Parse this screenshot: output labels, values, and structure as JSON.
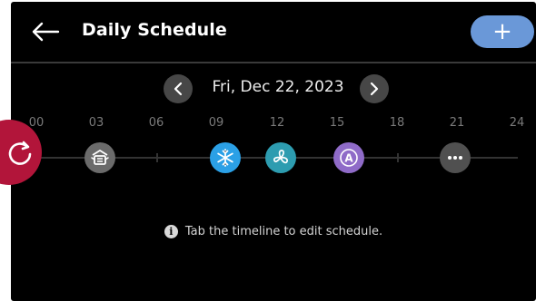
{
  "header": {
    "title": "Daily Schedule",
    "add_label": "+"
  },
  "date_nav": {
    "date": "Fri, Dec 22, 2023"
  },
  "timeline": {
    "hour_labels": [
      "00",
      "03",
      "06",
      "09",
      "12",
      "15",
      "18",
      "21",
      "24"
    ],
    "events": [
      {
        "name": "dehumidify-event",
        "icon": "dehumidify-icon",
        "color": "#6b6b6b"
      },
      {
        "name": "cool-event",
        "icon": "snowflake-icon",
        "color": "#2ba0e6"
      },
      {
        "name": "fan-event",
        "icon": "fan-icon",
        "color": "#2d9cb0"
      },
      {
        "name": "auto-event",
        "icon": "auto-mode-icon",
        "color": "#8f6bc8",
        "label": "A"
      },
      {
        "name": "more-event",
        "icon": "more-icon",
        "color": "#505050"
      }
    ]
  },
  "info": {
    "text": "Tab the timeline to edit schedule."
  },
  "overlay": {
    "icon": "refresh-icon",
    "color": "#b2153a"
  }
}
